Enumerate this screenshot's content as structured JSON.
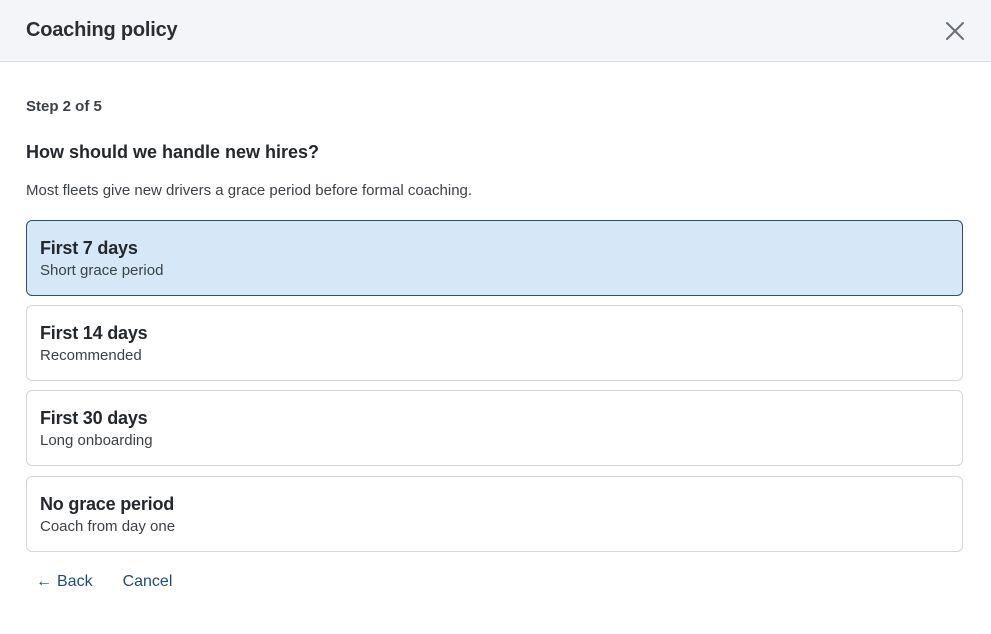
{
  "dialog": {
    "title": "Coaching policy",
    "close_icon": "close-icon"
  },
  "wizard": {
    "step_label": "Step 2 of 5",
    "question": "How should we handle new hires?",
    "description": "Most fleets give new drivers a grace period before formal coaching."
  },
  "options": [
    {
      "title": "First 7 days",
      "subtitle": "Short grace period",
      "selected": true
    },
    {
      "title": "First 14 days",
      "subtitle": "Recommended",
      "selected": false
    },
    {
      "title": "First 30 days",
      "subtitle": "Long onboarding",
      "selected": false
    },
    {
      "title": "No grace period",
      "subtitle": "Coach from day one",
      "selected": false
    }
  ],
  "footer": {
    "back_arrow": "←",
    "back_label": "Back",
    "cancel_label": "Cancel"
  },
  "colors": {
    "selected_bg": "#d6e8f7",
    "selected_border": "#2f4f6e",
    "link": "#1f4a7a",
    "header_bg": "#f4f5f8"
  }
}
